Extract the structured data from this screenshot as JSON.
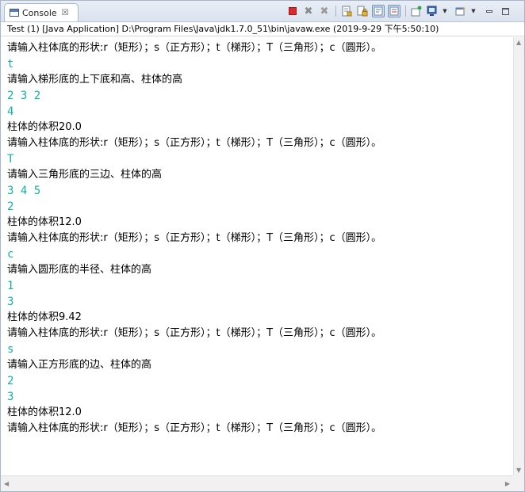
{
  "tab": {
    "label": "Console",
    "close": "☒"
  },
  "process_info": "Test (1) [Java Application] D:\\Program Files\\Java\\jdk1.7.0_51\\bin\\javaw.exe (2019-9-29 下午5:50:10)",
  "console_lines": [
    {
      "text": "请输入柱体底的形状:r（矩形）；s（正方形）；t（梯形）；T（三角形）；c（圆形）。",
      "kind": "out"
    },
    {
      "text": "t",
      "kind": "in"
    },
    {
      "text": "请输入梯形底的上下底和高、柱体的高",
      "kind": "out"
    },
    {
      "text": "2 3 2",
      "kind": "in"
    },
    {
      "text": "4",
      "kind": "in"
    },
    {
      "text": "柱体的体积20.0",
      "kind": "out"
    },
    {
      "text": "请输入柱体底的形状:r（矩形）；s（正方形）；t（梯形）；T（三角形）；c（圆形）。",
      "kind": "out"
    },
    {
      "text": "T",
      "kind": "in"
    },
    {
      "text": "请输入三角形底的三边、柱体的高",
      "kind": "out"
    },
    {
      "text": "3 4 5",
      "kind": "in"
    },
    {
      "text": "2",
      "kind": "in"
    },
    {
      "text": "柱体的体积12.0",
      "kind": "out"
    },
    {
      "text": "请输入柱体底的形状:r（矩形）；s（正方形）；t（梯形）；T（三角形）；c（圆形）。",
      "kind": "out"
    },
    {
      "text": "c",
      "kind": "in"
    },
    {
      "text": "请输入圆形底的半径、柱体的高",
      "kind": "out"
    },
    {
      "text": "1",
      "kind": "in"
    },
    {
      "text": "3",
      "kind": "in"
    },
    {
      "text": "柱体的体积9.42",
      "kind": "out"
    },
    {
      "text": "请输入柱体底的形状:r（矩形）；s（正方形）；t（梯形）；T（三角形）；c（圆形）。",
      "kind": "out"
    },
    {
      "text": "s",
      "kind": "in"
    },
    {
      "text": "请输入正方形底的边、柱体的高",
      "kind": "out"
    },
    {
      "text": "2",
      "kind": "in"
    },
    {
      "text": "3",
      "kind": "in"
    },
    {
      "text": "柱体的体积12.0",
      "kind": "out"
    },
    {
      "text": "请输入柱体底的形状:r（矩形）；s（正方形）；t（梯形）；T（三角形）；c（圆形）。",
      "kind": "out"
    }
  ],
  "colors": {
    "input_text": "#15b39a",
    "output_text": "#000000",
    "terminate": "#d92b2b"
  },
  "icons": {
    "console": "console-icon",
    "terminate": "terminate-icon",
    "remove_launch": "remove-launch-icon",
    "remove_all": "remove-all-terminated-icon",
    "clear": "clear-console-icon",
    "scroll_lock": "scroll-lock-icon",
    "word_wrap": "word-wrap-icon",
    "show_on_output": "show-console-on-output-icon",
    "pin": "pin-console-icon",
    "display_selected": "display-selected-console-icon",
    "open_console": "open-console-icon",
    "minimize": "minimize-icon",
    "maximize": "maximize-icon"
  }
}
